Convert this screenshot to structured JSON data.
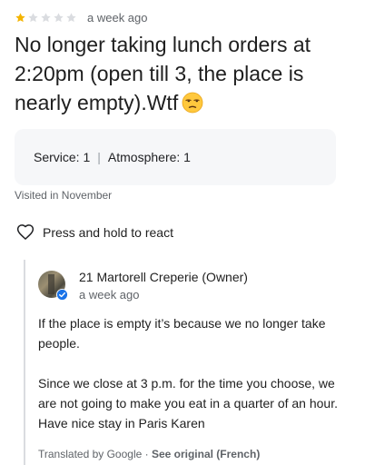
{
  "review": {
    "rating": 1,
    "max_rating": 5,
    "age": "a week ago",
    "text": "No longer taking lunch orders at 2:20pm (open till 3, the place is nearly empty).Wtf",
    "emoji_icon": "unamused-face-icon",
    "attributes": {
      "service_label": "Service:",
      "service_value": "1",
      "atmosphere_label": "Atmosphere:",
      "atmosphere_value": "1"
    },
    "visited": "Visited in November",
    "react_label": "Press and hold to react"
  },
  "owner_response": {
    "name": "21 Martorell Creperie (Owner)",
    "age": "a week ago",
    "paragraph_1": "If the place is empty it’s because we no longer take people.",
    "paragraph_2": "Since we close at 3 p.m. for the time you choose, we are not going to make you eat in a quarter of an hour. Have nice stay in Paris Karen",
    "translated_by": "Translated by Google · ",
    "see_original": "See original (French)"
  },
  "colors": {
    "star_filled": "#f4b400",
    "star_empty": "#dadce0",
    "verified": "#1a73e8"
  }
}
